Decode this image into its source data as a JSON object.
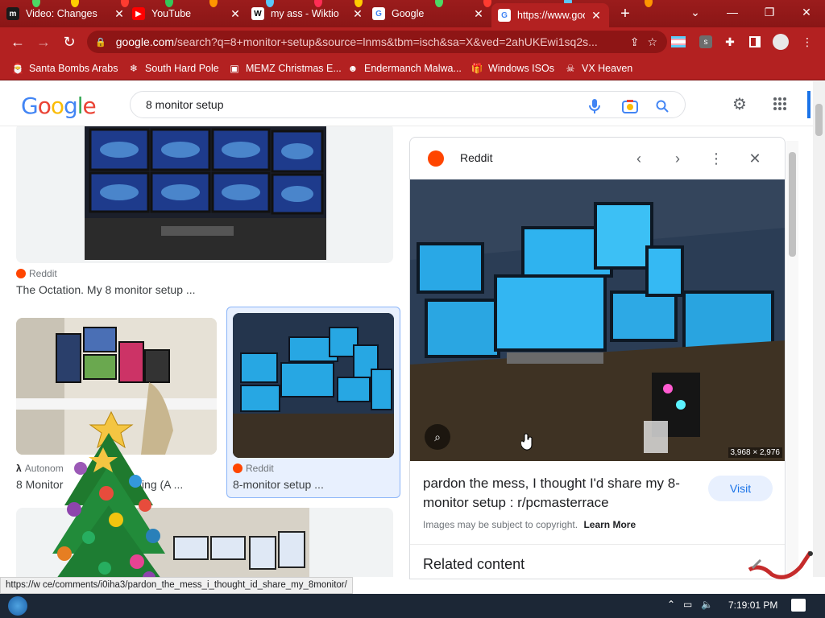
{
  "tabs": [
    {
      "title": "Video: Changes",
      "fav": "m",
      "favbg": "#1a1a1a",
      "favfg": "#ffffff"
    },
    {
      "title": "YouTube",
      "fav": "▶",
      "favbg": "#ff0000",
      "favfg": "#ffffff"
    },
    {
      "title": "my ass - Wiktio",
      "fav": "W",
      "favbg": "#ffffff",
      "favfg": "#000000"
    },
    {
      "title": "Google",
      "fav": "G",
      "favbg": "#ffffff",
      "favfg": "#4285f4"
    },
    {
      "title": "https://www.goo",
      "fav": "G",
      "favbg": "#ffffff",
      "favfg": "#4285f4"
    }
  ],
  "tab_close_glyph": "✕",
  "new_tab_glyph": "+",
  "window": {
    "minimize": "—",
    "restore": "❐",
    "close": "✕",
    "tabsearch": "⌄"
  },
  "omnibox": {
    "host": "google.com",
    "path": "/search?q=8+monitor+setup&source=lnms&tbm=isch&sa=X&ved=2ahUKEwi1sq2s..."
  },
  "bookmarks": [
    {
      "label": "Santa Bombs Arabs",
      "icon": "santa-icon",
      "glyph": "🎅"
    },
    {
      "label": "South Hard Pole",
      "icon": "snowflake-icon",
      "glyph": "❄"
    },
    {
      "label": "MEMZ Christmas E...",
      "icon": "page-icon",
      "glyph": "▣"
    },
    {
      "label": "Endermanch Malwa...",
      "icon": "raccoon-icon",
      "glyph": "☻"
    },
    {
      "label": "Windows ISOs",
      "icon": "gift-icon",
      "glyph": "🎁"
    },
    {
      "label": "VX Heaven",
      "icon": "skull-icon",
      "glyph": "☠"
    }
  ],
  "google": {
    "logo": [
      "G",
      "o",
      "o",
      "g",
      "l",
      "e"
    ],
    "logo_colors": [
      "#4285f4",
      "#ea4335",
      "#fbbc05",
      "#4285f4",
      "#34a853",
      "#ea4335"
    ],
    "query": "8 monitor setup"
  },
  "results": [
    {
      "source": "Reddit",
      "title": "The Octation. My 8 monitor setup ..."
    },
    {
      "source": "Autonom",
      "title": "8 Monitor",
      "title_tail": "ading (A ..."
    },
    {
      "source": "Reddit",
      "title": "8-monitor setup ..."
    }
  ],
  "panel": {
    "source": "Reddit",
    "dimensions": "3,968 × 2,976",
    "title": "pardon the mess, I thought I'd share my 8-monitor setup : r/pcmasterrace",
    "visit": "Visit",
    "copyright": "Images may be subject to copyright.",
    "learn_more": "Learn More",
    "related": "Related content"
  },
  "status_url": "https://w          ce/comments/i0iha3/pardon_the_mess_i_thought_id_share_my_8monitor/",
  "clock": "7:19:01 PM",
  "colors": {
    "chrome_red": "#b32121",
    "reddit_orange": "#ff4500",
    "visit_bg": "#e8f0fe",
    "visit_fg": "#1a73e8"
  }
}
